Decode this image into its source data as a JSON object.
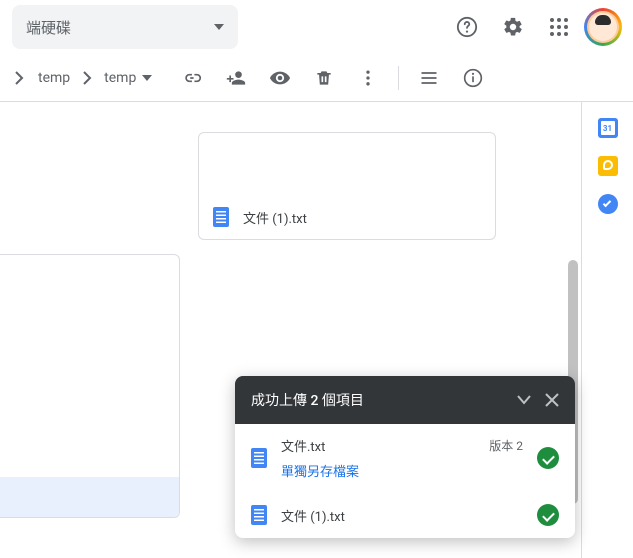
{
  "header": {
    "search_text": "端硬碟"
  },
  "breadcrumbs": {
    "items": [
      "",
      "temp",
      "temp"
    ]
  },
  "file_grid": {
    "file_name": "文件 (1).txt"
  },
  "upload": {
    "title": "成功上傳 2 個項目",
    "items": [
      {
        "name": "文件.txt",
        "version": "版本 2",
        "link": "單獨另存檔案"
      },
      {
        "name": "文件 (1).txt"
      }
    ]
  }
}
